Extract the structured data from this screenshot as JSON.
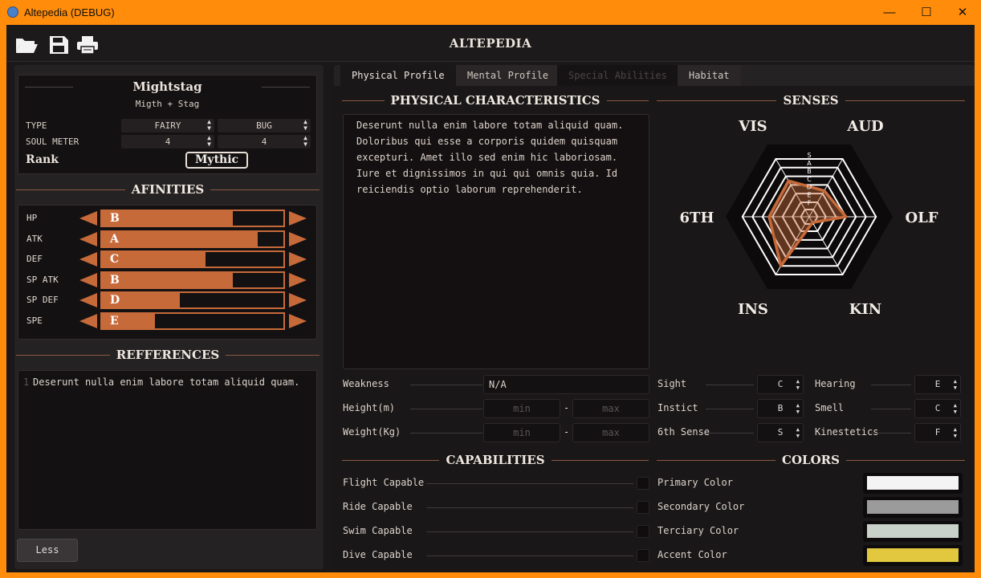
{
  "window": {
    "title": "Altepedia (DEBUG)",
    "minimize": "—",
    "maximize": "☐",
    "close": "✕"
  },
  "header": {
    "title": "ALTEPEDIA",
    "icons": [
      "folder-open-icon",
      "save-icon",
      "print-icon"
    ]
  },
  "creature": {
    "name": "Mightstag",
    "origin": "Migth + Stag",
    "type_label": "TYPE",
    "type1": "FAIRY",
    "type2": "BUG",
    "soul_label": "SOUL METER",
    "soul1": "4",
    "soul2": "4",
    "rank_label": "Rank",
    "rank_value": "Mythic"
  },
  "affinities": {
    "title": "AFINITIES",
    "rows": [
      {
        "label": "HP",
        "rank": "B",
        "level": 0.72
      },
      {
        "label": "ATK",
        "rank": "A",
        "level": 0.86
      },
      {
        "label": "DEF",
        "rank": "C",
        "level": 0.57
      },
      {
        "label": "SP ATK",
        "rank": "B",
        "level": 0.72
      },
      {
        "label": "SP DEF",
        "rank": "D",
        "level": 0.43
      },
      {
        "label": "SPE",
        "rank": "E",
        "level": 0.29
      }
    ],
    "color": "#c76a3a"
  },
  "references": {
    "title": "REFFERENCES",
    "line_number": "1",
    "text": "Deserunt nulla enim labore totam aliquid quam."
  },
  "less_button": "Less",
  "tabs": [
    {
      "label": "Physical Profile",
      "state": "active"
    },
    {
      "label": "Mental Profile",
      "state": "normal"
    },
    {
      "label": "Special Abilities",
      "state": "disabled"
    },
    {
      "label": "Habitat",
      "state": "normal"
    }
  ],
  "physical": {
    "title": "PHYSICAL CHARACTERISTICS",
    "lines": [
      "Deserunt nulla enim labore totam aliquid quam.",
      "Doloribus qui esse a corporis quidem quisquam",
      "excepturi. Amet illo sed enim hic laboriosam.",
      "Iure et dignissimos in qui qui omnis quia. Id",
      "reiciendis optio laborum reprehenderit."
    ],
    "weakness_label": "Weakness",
    "weakness_value": "N/A",
    "height_label": "Height(m)",
    "weight_label": "Weight(Kg)",
    "min_placeholder": "min",
    "max_placeholder": "max",
    "dash": "-"
  },
  "senses": {
    "title": "SENSES",
    "axes": [
      "VIS",
      "AUD",
      "OLF",
      "KIN",
      "INS",
      "6TH"
    ],
    "scale": [
      "S",
      "A",
      "B",
      "C",
      "D",
      "E",
      "F"
    ],
    "values": [
      0.62,
      0.45,
      0.55,
      0.1,
      0.85,
      0.6
    ],
    "fields": [
      {
        "label": "Sight",
        "value": "C"
      },
      {
        "label": "Hearing",
        "value": "E"
      },
      {
        "label": "Instict",
        "value": "B"
      },
      {
        "label": "Smell",
        "value": "C"
      },
      {
        "label": "6th Sense",
        "value": "S"
      },
      {
        "label": "Kinestetics",
        "value": "F"
      }
    ]
  },
  "capabilities": {
    "title": "CAPABILITIES",
    "items": [
      "Flight Capable",
      "Ride Capable",
      "Swim Capable",
      "Dive Capable"
    ]
  },
  "colors": {
    "title": "COLORS",
    "items": [
      {
        "label": "Primary Color",
        "hex": "#f4f4f4"
      },
      {
        "label": "Secondary Color",
        "hex": "#9b9b9b"
      },
      {
        "label": "Terciary Color",
        "hex": "#c8d2c8"
      },
      {
        "label": "Accent Color",
        "hex": "#e2c83e"
      }
    ]
  }
}
